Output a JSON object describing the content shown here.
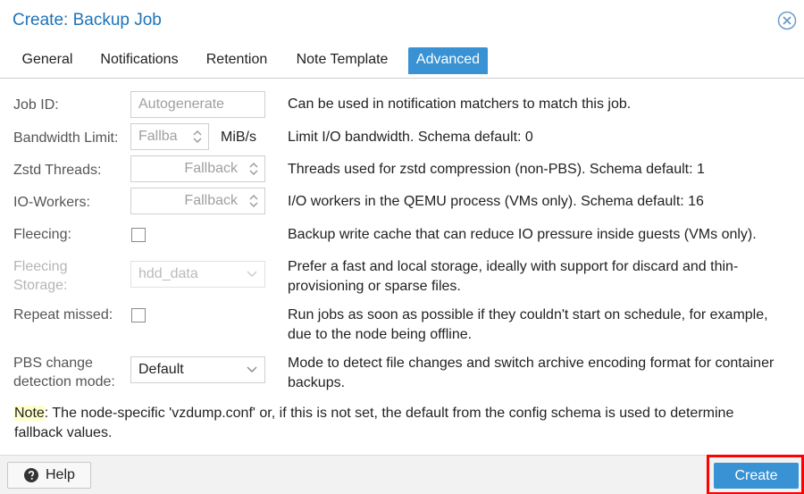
{
  "window": {
    "title": "Create: Backup Job",
    "close_icon": "close-circle-icon"
  },
  "tabs": [
    {
      "label": "General"
    },
    {
      "label": "Notifications"
    },
    {
      "label": "Retention"
    },
    {
      "label": "Note Template"
    },
    {
      "label": "Advanced",
      "active": true
    }
  ],
  "form": {
    "job_id": {
      "label": "Job ID:",
      "placeholder": "Autogenerate",
      "description": "Can be used in notification matchers to match this job."
    },
    "bandwidth": {
      "label": "Bandwidth Limit:",
      "placeholder": "Fallba",
      "unit": "MiB/s",
      "description": "Limit I/O bandwidth. Schema default: 0"
    },
    "zstd": {
      "label": "Zstd Threads:",
      "placeholder": "Fallback",
      "description": "Threads used for zstd compression (non-PBS). Schema default: 1"
    },
    "io_workers": {
      "label": "IO-Workers:",
      "placeholder": "Fallback",
      "description": "I/O workers in the QEMU process (VMs only). Schema default: 16"
    },
    "fleecing": {
      "label": "Fleecing:",
      "checked": false,
      "description": "Backup write cache that can reduce IO pressure inside guests (VMs only)."
    },
    "fleecing_storage": {
      "label_line1": "Fleecing",
      "label_line2": "Storage:",
      "value": "hdd_data",
      "description": "Prefer a fast and local storage, ideally with support for discard and thin-provisioning or sparse files."
    },
    "repeat_missed": {
      "label": "Repeat missed:",
      "checked": false,
      "description": "Run jobs as soon as possible if they couldn't start on schedule, for example, due to the node being offline."
    },
    "pbs_mode": {
      "label_line1": "PBS change",
      "label_line2": "detection mode:",
      "value": "Default",
      "description": "Mode to detect file changes and switch archive encoding format for container backups."
    }
  },
  "note": {
    "keyword": "Note",
    "text": ": The node-specific 'vzdump.conf' or, if this is not set, the default from the config schema is used to determine fallback values."
  },
  "footer": {
    "help_label": "Help",
    "create_label": "Create"
  },
  "colors": {
    "accent": "#3892d4",
    "title": "#1e73b8",
    "highlight": "#ff0000"
  }
}
